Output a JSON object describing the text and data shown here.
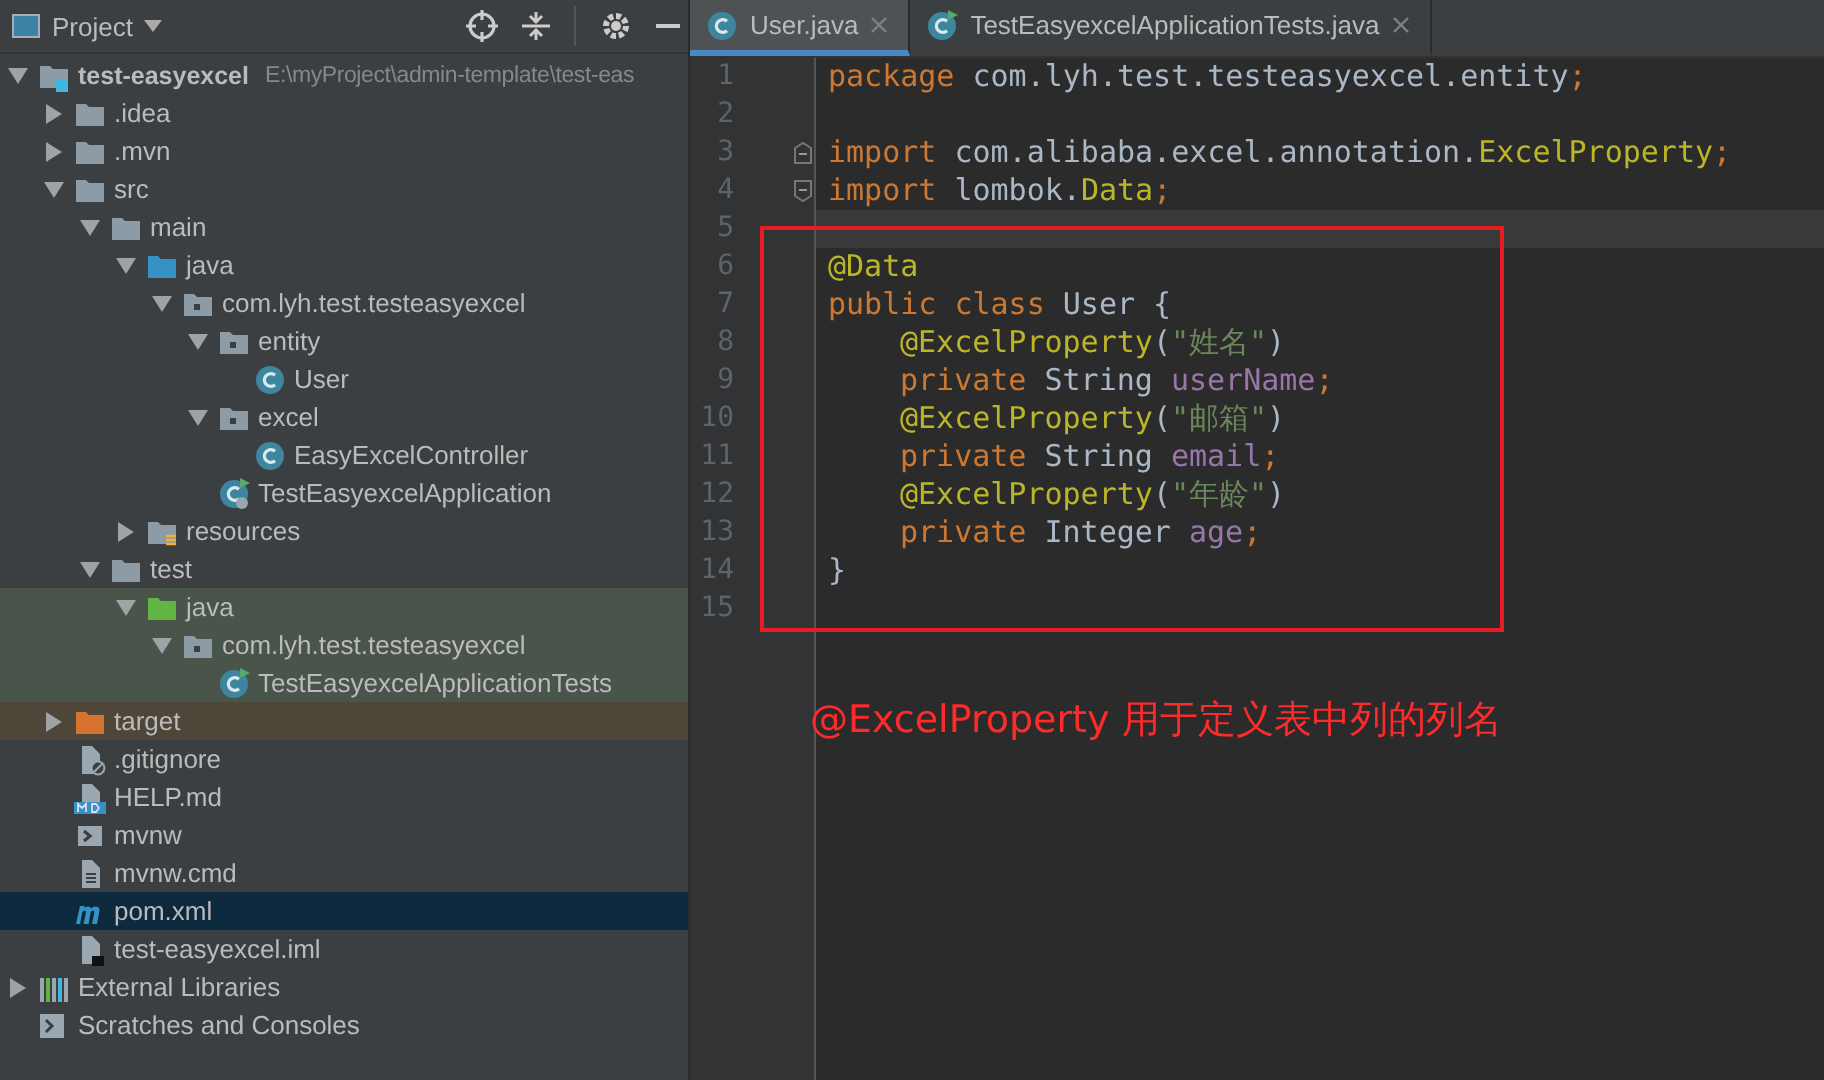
{
  "project_panel": {
    "title": "Project",
    "tree": [
      {
        "label": "test-easyexcel",
        "path": "E:\\myProject\\admin-template\\test-eas",
        "kind": "project-folder",
        "expanded": true,
        "selected": false,
        "children": [
          {
            "label": ".idea",
            "kind": "folder",
            "expanded": false,
            "selected": false
          },
          {
            "label": ".mvn",
            "kind": "folder",
            "expanded": false,
            "selected": false
          },
          {
            "label": "src",
            "kind": "folder",
            "expanded": true,
            "selected": false,
            "children": [
              {
                "label": "main",
                "kind": "folder",
                "expanded": true,
                "selected": false,
                "children": [
                  {
                    "label": "java",
                    "kind": "source-folder",
                    "expanded": true,
                    "selected": false,
                    "children": [
                      {
                        "label": "com.lyh.test.testeasyexcel",
                        "kind": "package",
                        "expanded": true,
                        "selected": false,
                        "children": [
                          {
                            "label": "entity",
                            "kind": "package",
                            "expanded": true,
                            "selected": false,
                            "children": [
                              {
                                "label": "User",
                                "kind": "class",
                                "selected": false
                              }
                            ]
                          },
                          {
                            "label": "excel",
                            "kind": "package",
                            "expanded": true,
                            "selected": false,
                            "children": [
                              {
                                "label": "EasyExcelController",
                                "kind": "class",
                                "selected": false
                              }
                            ]
                          },
                          {
                            "label": "TestEasyexcelApplication",
                            "kind": "app-class",
                            "selected": false
                          }
                        ]
                      }
                    ]
                  },
                  {
                    "label": "resources",
                    "kind": "resource-folder",
                    "expanded": false,
                    "selected": false
                  }
                ]
              },
              {
                "label": "test",
                "kind": "folder",
                "expanded": true,
                "selected": false,
                "children": [
                  {
                    "label": "java",
                    "kind": "test-folder",
                    "expanded": true,
                    "selected": false,
                    "children": [
                      {
                        "label": "com.lyh.test.testeasyexcel",
                        "kind": "package",
                        "expanded": true,
                        "selected": false,
                        "children": [
                          {
                            "label": "TestEasyexcelApplicationTests",
                            "kind": "test-class",
                            "selected": false
                          }
                        ]
                      }
                    ]
                  }
                ]
              }
            ]
          },
          {
            "label": "target",
            "kind": "excluded-folder",
            "expanded": false,
            "selected": false
          },
          {
            "label": ".gitignore",
            "kind": "ignore-file",
            "selected": false
          },
          {
            "label": "HELP.md",
            "kind": "md-file",
            "selected": false
          },
          {
            "label": "mvnw",
            "kind": "exec-file",
            "selected": false
          },
          {
            "label": "mvnw.cmd",
            "kind": "text-file",
            "selected": false
          },
          {
            "label": "pom.xml",
            "kind": "maven-file",
            "selected": true
          },
          {
            "label": "test-easyexcel.iml",
            "kind": "iml-file",
            "selected": false
          }
        ]
      },
      {
        "label": "External Libraries",
        "kind": "libraries",
        "expanded": false,
        "selected": false
      },
      {
        "label": "Scratches and Consoles",
        "kind": "scratches",
        "selected": false
      }
    ]
  },
  "editor": {
    "tabs": [
      {
        "label": "User.java",
        "kind": "class",
        "selected": true
      },
      {
        "label": "TestEasyexcelApplicationTests.java",
        "kind": "test-class",
        "selected": false
      }
    ],
    "lines": [
      {
        "number": "1",
        "kind": "plain",
        "current": false,
        "indented": false,
        "tokens": [
          {
            "kind": "keyword",
            "text": "package "
          },
          {
            "kind": "plain",
            "text": "com.lyh.test.testeasyexcel.entity"
          },
          {
            "kind": "keyword",
            "text": ";"
          }
        ]
      },
      {
        "number": "2",
        "kind": "plain",
        "current": false
      },
      {
        "number": "3",
        "kind": "fold-start",
        "current": false,
        "indented": false,
        "tokens": [
          {
            "kind": "keyword",
            "text": "import "
          },
          {
            "kind": "plain",
            "text": "com.alibaba.excel.annotation."
          },
          {
            "kind": "annotation",
            "text": "ExcelProperty"
          },
          {
            "kind": "keyword",
            "text": ";"
          }
        ]
      },
      {
        "number": "4",
        "kind": "fold-end",
        "current": false,
        "indented": false,
        "tokens": [
          {
            "kind": "keyword",
            "text": "import "
          },
          {
            "kind": "plain",
            "text": "lombok."
          },
          {
            "kind": "annotation",
            "text": "Data"
          },
          {
            "kind": "keyword",
            "text": ";"
          }
        ]
      },
      {
        "number": "5",
        "kind": "plain",
        "current": true
      },
      {
        "number": "6",
        "kind": "plain",
        "current": false,
        "indented": false,
        "tokens": [
          {
            "kind": "annotation",
            "text": "@Data"
          }
        ]
      },
      {
        "number": "7",
        "kind": "plain",
        "current": false,
        "indented": false,
        "tokens": [
          {
            "kind": "keyword",
            "text": "public class "
          },
          {
            "kind": "plain",
            "text": "User {"
          }
        ]
      },
      {
        "number": "8",
        "kind": "plain",
        "current": false,
        "indented": true,
        "tokens": [
          {
            "kind": "annotation",
            "text": "@ExcelProperty"
          },
          {
            "kind": "plain",
            "text": "("
          },
          {
            "kind": "string",
            "text": "\"姓名\""
          },
          {
            "kind": "plain",
            "text": ")"
          }
        ]
      },
      {
        "number": "9",
        "kind": "plain",
        "current": false,
        "indented": true,
        "tokens": [
          {
            "kind": "keyword",
            "text": "private "
          },
          {
            "kind": "plain",
            "text": "String "
          },
          {
            "kind": "field",
            "text": "userName"
          },
          {
            "kind": "keyword",
            "text": ";"
          }
        ]
      },
      {
        "number": "10",
        "kind": "plain",
        "current": false,
        "indented": true,
        "tokens": [
          {
            "kind": "annotation",
            "text": "@ExcelProperty"
          },
          {
            "kind": "plain",
            "text": "("
          },
          {
            "kind": "string",
            "text": "\"邮箱\""
          },
          {
            "kind": "plain",
            "text": ")"
          }
        ]
      },
      {
        "number": "11",
        "kind": "plain",
        "current": false,
        "indented": true,
        "tokens": [
          {
            "kind": "keyword",
            "text": "private "
          },
          {
            "kind": "plain",
            "text": "String "
          },
          {
            "kind": "field",
            "text": "email"
          },
          {
            "kind": "keyword",
            "text": ";"
          }
        ]
      },
      {
        "number": "12",
        "kind": "plain",
        "current": false,
        "indented": true,
        "tokens": [
          {
            "kind": "annotation",
            "text": "@ExcelProperty"
          },
          {
            "kind": "plain",
            "text": "("
          },
          {
            "kind": "string",
            "text": "\"年龄\""
          },
          {
            "kind": "plain",
            "text": ")"
          }
        ]
      },
      {
        "number": "13",
        "kind": "plain",
        "current": false,
        "indented": true,
        "tokens": [
          {
            "kind": "keyword",
            "text": "private "
          },
          {
            "kind": "plain",
            "text": "Integer "
          },
          {
            "kind": "field",
            "text": "age"
          },
          {
            "kind": "keyword",
            "text": ";"
          }
        ]
      },
      {
        "number": "14",
        "kind": "plain",
        "current": false,
        "indented": false,
        "tokens": [
          {
            "kind": "plain",
            "text": "}"
          }
        ]
      },
      {
        "number": "15",
        "kind": "plain",
        "current": false
      }
    ],
    "annotation_note": "@ExcelProperty 用于定义表中列的列名"
  }
}
